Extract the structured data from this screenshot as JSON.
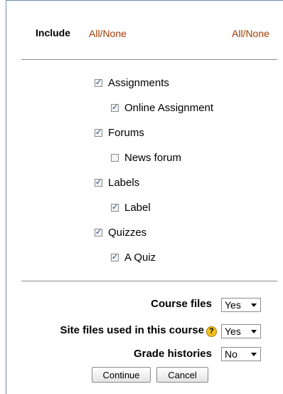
{
  "header": {
    "include_label": "Include",
    "all_none_left": "All/None",
    "all_none_right": "All/None"
  },
  "items": [
    {
      "label": "Assignments",
      "checked": true
    },
    {
      "label": "Online Assignment",
      "checked": true
    },
    {
      "label": "Forums",
      "checked": true
    },
    {
      "label": "News forum",
      "checked": false
    },
    {
      "label": "Labels",
      "checked": true
    },
    {
      "label": "Label",
      "checked": true
    },
    {
      "label": "Quizzes",
      "checked": true
    },
    {
      "label": "A Quiz",
      "checked": true
    }
  ],
  "options": {
    "course_files": {
      "label": "Course files",
      "value": "Yes"
    },
    "site_files": {
      "label": "Site files used in this course",
      "value": "Yes",
      "help_icon": "help-icon"
    },
    "grade_histories": {
      "label": "Grade histories",
      "value": "No"
    }
  },
  "buttons": {
    "continue": "Continue",
    "cancel": "Cancel"
  }
}
